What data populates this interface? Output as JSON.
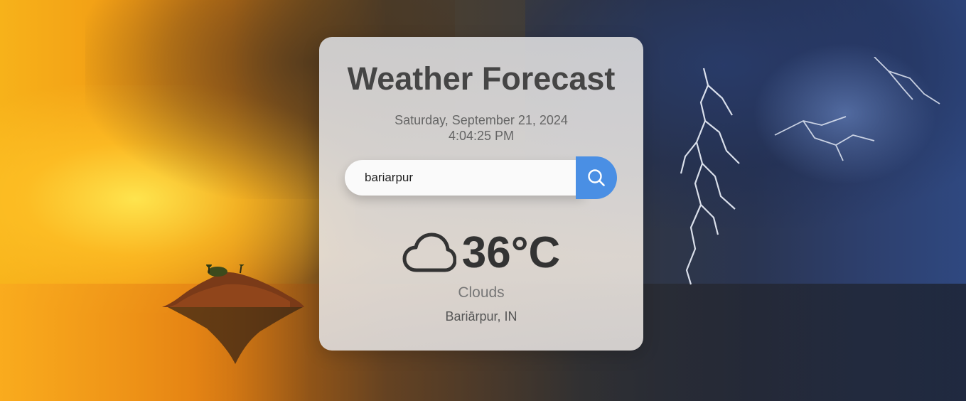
{
  "app": {
    "title": "Weather Forecast"
  },
  "datetime": {
    "date": "Saturday, September 21, 2024",
    "time": "4:04:25 PM"
  },
  "search": {
    "value": "bariarpur",
    "button_icon": "search-icon"
  },
  "weather": {
    "icon": "cloud-icon",
    "temperature": "36°C",
    "condition": "Clouds",
    "location": "Bariārpur, IN"
  },
  "colors": {
    "accent": "#4a8fe4",
    "title": "#454545",
    "temperature": "#333333"
  }
}
